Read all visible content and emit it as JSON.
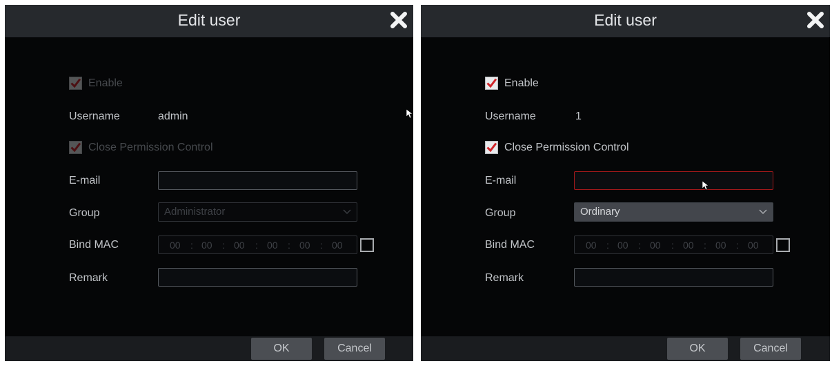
{
  "dialogs": [
    {
      "title": "Edit user",
      "enable_label": "Enable",
      "enable_checked": true,
      "enable_disabled": true,
      "username_label": "Username",
      "username_value": "admin",
      "close_permission_label": "Close Permission Control",
      "close_permission_checked": true,
      "close_permission_disabled": true,
      "email_label": "E-mail",
      "email_value": "",
      "group_label": "Group",
      "group_value": "Administrator",
      "group_disabled": true,
      "bind_mac_label": "Bind MAC",
      "mac_octets": [
        "00",
        "00",
        "00",
        "00",
        "00",
        "00"
      ],
      "mac_separator": ":",
      "bind_mac_checked": false,
      "remark_label": "Remark",
      "remark_value": "",
      "ok_label": "OK",
      "cancel_label": "Cancel"
    },
    {
      "title": "Edit user",
      "enable_label": "Enable",
      "enable_checked": true,
      "enable_disabled": false,
      "username_label": "Username",
      "username_value": "1",
      "close_permission_label": "Close Permission Control",
      "close_permission_checked": true,
      "close_permission_disabled": false,
      "email_label": "E-mail",
      "email_value": "",
      "email_focused": true,
      "group_label": "Group",
      "group_value": "Ordinary",
      "group_disabled": false,
      "bind_mac_label": "Bind MAC",
      "mac_octets": [
        "00",
        "00",
        "00",
        "00",
        "00",
        "00"
      ],
      "mac_separator": ":",
      "bind_mac_checked": false,
      "remark_label": "Remark",
      "remark_value": "",
      "ok_label": "OK",
      "cancel_label": "Cancel"
    }
  ],
  "icons": {
    "close": "close-x-icon",
    "check": "checkmark-icon",
    "dropdown": "chevron-down-icon",
    "cursor": "mouse-pointer-icon"
  },
  "colors": {
    "check_red": "#d0252a",
    "focus_border": "#a3191b",
    "title_bar": "#26292d",
    "background": "#050607"
  }
}
